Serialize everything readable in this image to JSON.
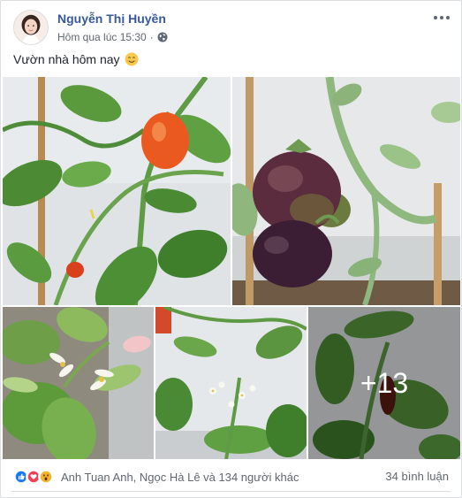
{
  "post": {
    "author": "Nguyễn Thị Huyền",
    "timestamp": "Hôm qua lúc 15:30",
    "separator": "·",
    "privacy_icon": "globe-icon",
    "text": "Vườn nhà hôm nay",
    "emoji": "smiling-face-emoji",
    "more_icon": "more-options-icon"
  },
  "photos": {
    "count_overlay": "+13",
    "items": [
      {
        "name": "orange-pepper-photo"
      },
      {
        "name": "purple-tomato-photo"
      },
      {
        "name": "pepper-flower-photo"
      },
      {
        "name": "pepper-blossoms-photo"
      },
      {
        "name": "pepper-plant-photo"
      }
    ]
  },
  "footer": {
    "reactions": [
      "like-icon",
      "love-icon",
      "wow-icon"
    ],
    "likers": "Anh Tuan Anh, Ngọc Hà Lê và 134 người khác",
    "comments": "34 bình luận"
  },
  "colors": {
    "link": "#385898",
    "secondary_text": "#616770",
    "like": "#1877f2",
    "love": "#f33e58",
    "wow": "#f7b125"
  }
}
